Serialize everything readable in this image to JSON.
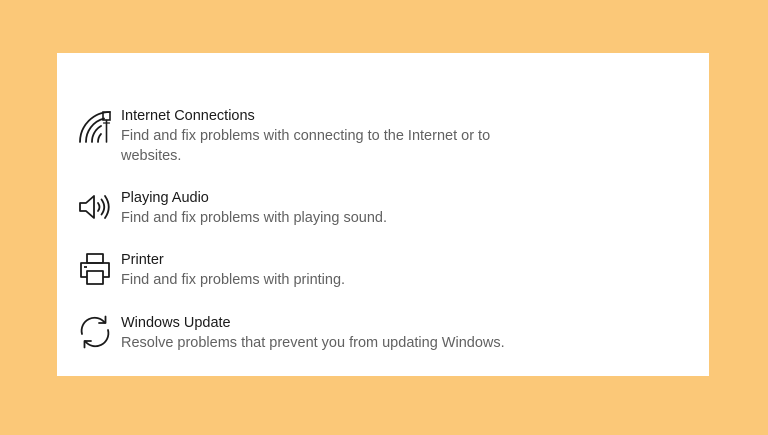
{
  "troubleshooters": [
    {
      "title": "Internet Connections",
      "description": "Find and fix problems with connecting to the Internet or to websites.",
      "icon": "network-wifi-icon"
    },
    {
      "title": "Playing Audio",
      "description": "Find and fix problems with playing sound.",
      "icon": "speaker-icon"
    },
    {
      "title": "Printer",
      "description": "Find and fix problems with printing.",
      "icon": "printer-icon"
    },
    {
      "title": "Windows Update",
      "description": "Resolve problems that prevent you from updating Windows.",
      "icon": "sync-arrows-icon"
    }
  ],
  "colors": {
    "background": "#fbc878",
    "panel": "#ffffff",
    "title_text": "#1a1a1a",
    "description_text": "#616161",
    "icon": "#1a1a1a"
  }
}
